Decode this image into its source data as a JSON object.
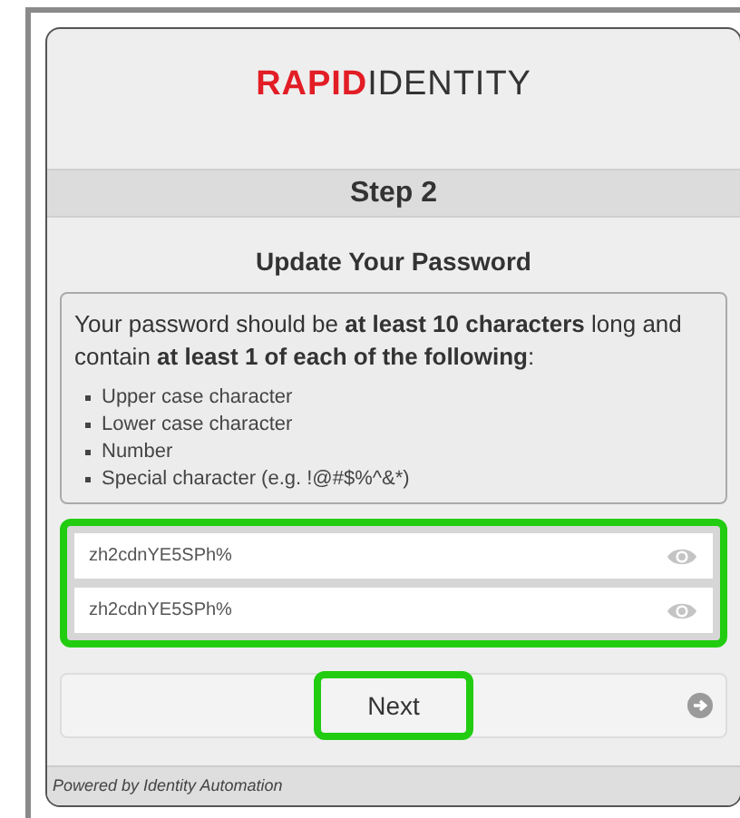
{
  "logo": {
    "strong": "RAPID",
    "light": "IDENTITY"
  },
  "step": "Step 2",
  "heading": "Update Your Password",
  "requirements": {
    "intro": "Your password should be **at least 10 characters** long and contain **at least 1 of each of the following**:",
    "items": [
      "Upper case character",
      "Lower case character",
      "Number",
      "Special character (e.g. !@#$%^&*)"
    ]
  },
  "fields_highlighted": true,
  "fields": [
    {
      "value": "zh2cdnYE5SPh%"
    },
    {
      "value": "zh2cdnYE5SPh%"
    }
  ],
  "next_button": {
    "label": "Next",
    "highlighted": true
  },
  "footer": "Powered by Identity Automation"
}
